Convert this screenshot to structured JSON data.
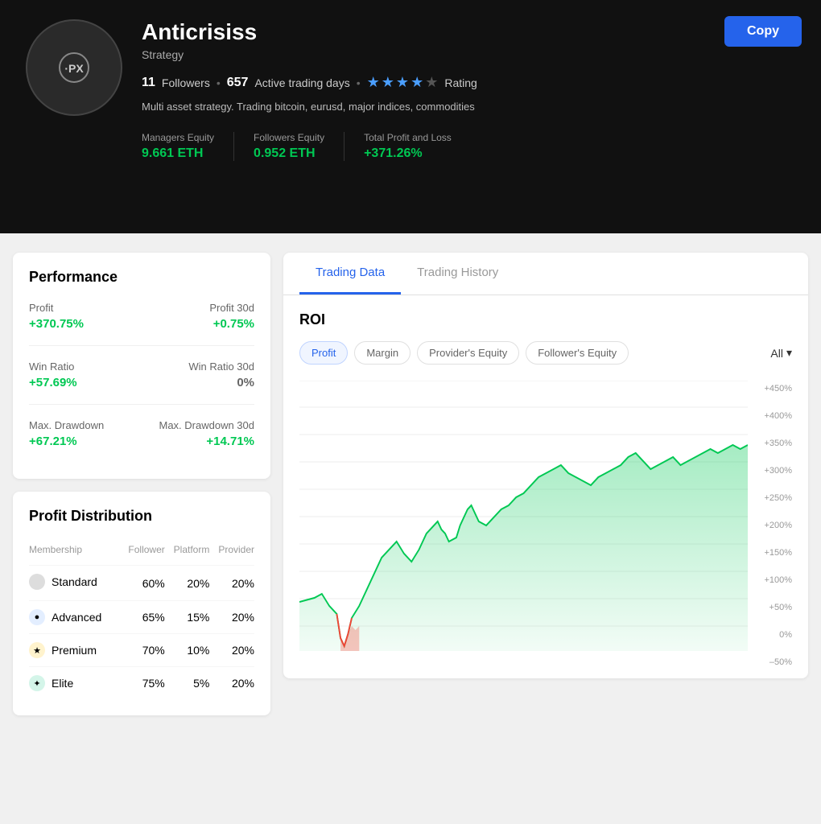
{
  "header": {
    "title": "Anticrisiss",
    "subtitle": "Strategy",
    "followers_count": "11",
    "followers_label": "Followers",
    "trading_days_count": "657",
    "trading_days_label": "Active trading days",
    "rating_label": "Rating",
    "description": "Multi asset strategy. Trading bitcoin, eurusd, major indices, commodities",
    "stats": [
      {
        "label": "Managers Equity",
        "value": "9.661 ETH"
      },
      {
        "label": "Followers Equity",
        "value": "0.952 ETH"
      },
      {
        "label": "Total Profit and Loss",
        "value": "+371.26%"
      }
    ],
    "copy_button": "Copy"
  },
  "performance": {
    "title": "Performance",
    "rows": [
      {
        "label": "Profit",
        "value": "+370.75%",
        "label2": "Profit 30d",
        "value2": "+0.75%"
      },
      {
        "label": "Win Ratio",
        "value": "+57.69%",
        "label2": "Win Ratio 30d",
        "value2": "0%"
      },
      {
        "label": "Max. Drawdown",
        "value": "+67.21%",
        "label2": "Max. Drawdown 30d",
        "value2": "+14.71%"
      }
    ]
  },
  "profit_distribution": {
    "title": "Profit Distribution",
    "headers": [
      "Membership",
      "Follower",
      "Platform",
      "Provider"
    ],
    "rows": [
      {
        "name": "Standard",
        "icon": "circle",
        "follower": "60%",
        "platform": "20%",
        "provider": "20%"
      },
      {
        "name": "Advanced",
        "icon": "blue",
        "follower": "65%",
        "platform": "15%",
        "provider": "20%"
      },
      {
        "name": "Premium",
        "icon": "yellow",
        "follower": "70%",
        "platform": "10%",
        "provider": "20%"
      },
      {
        "name": "Elite",
        "icon": "green-c",
        "follower": "75%",
        "platform": "5%",
        "provider": "20%"
      }
    ]
  },
  "chart_panel": {
    "tabs": [
      "Trading Data",
      "Trading History"
    ],
    "active_tab": "Trading Data",
    "roi_title": "ROI",
    "filters": [
      "Profit",
      "Margin",
      "Provider's Equity",
      "Follower's Equity"
    ],
    "active_filter": "Profit",
    "time_filter": "All",
    "y_labels": [
      "+450%",
      "+400%",
      "+350%",
      "+300%",
      "+250%",
      "+200%",
      "+150%",
      "+100%",
      "+50%",
      "0%",
      "–50%"
    ]
  },
  "colors": {
    "green": "#00c853",
    "blue": "#2563eb",
    "red": "#f44336"
  }
}
